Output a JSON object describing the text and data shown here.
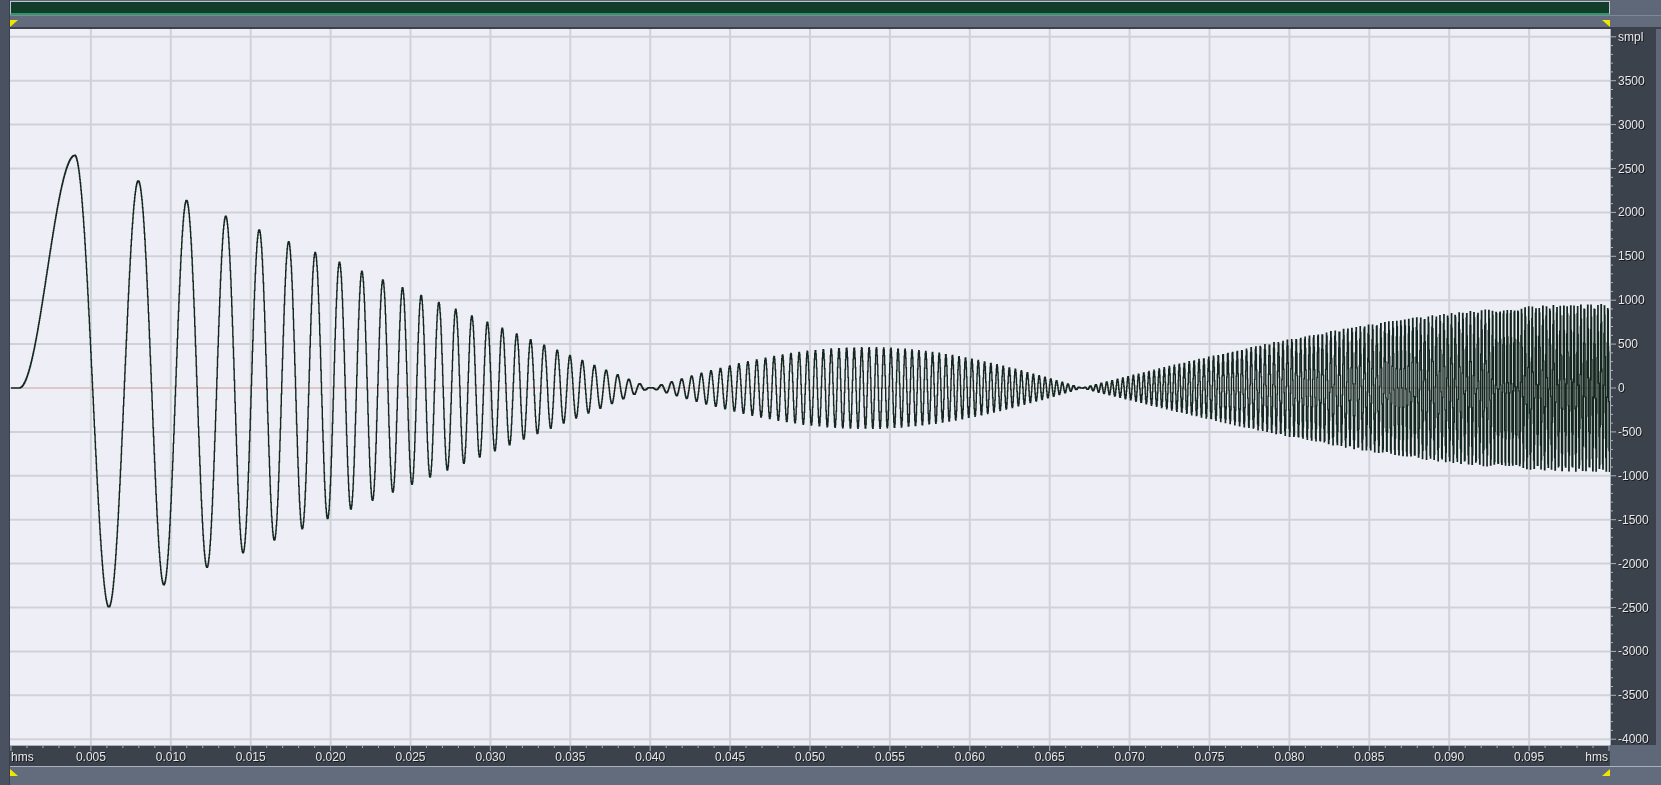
{
  "time_ruler": {
    "start_label": "hms",
    "end_label": "hms",
    "ticks": [
      "0.005",
      "0.010",
      "0.015",
      "0.020",
      "0.025",
      "0.030",
      "0.035",
      "0.040",
      "0.045",
      "0.050",
      "0.055",
      "0.060",
      "0.065",
      "0.070",
      "0.075",
      "0.080",
      "0.085",
      "0.090",
      "0.095"
    ]
  },
  "level_ruler": {
    "unit_label": "smpl",
    "ticks": [
      "3500",
      "3000",
      "2500",
      "2000",
      "1500",
      "1000",
      "500",
      "0",
      "-500",
      "-1000",
      "-1500",
      "-2000",
      "-2500",
      "-3000",
      "-3500",
      "-4000"
    ]
  }
}
